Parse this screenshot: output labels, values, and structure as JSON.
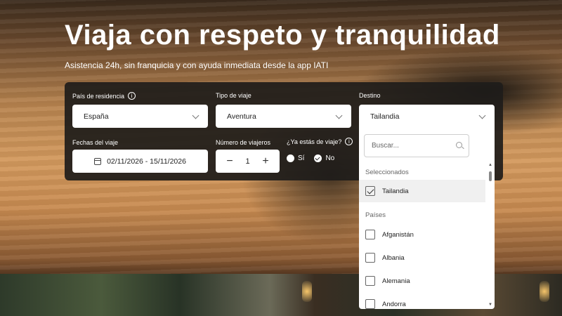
{
  "hero": {
    "title": "Viaja con respeto y tranquilidad",
    "subtitle": "Asistencia 24h, sin franquicia y con ayuda inmediata desde la app IATI"
  },
  "form": {
    "residence": {
      "label": "País de residencia",
      "value": "España",
      "icon": "info-icon"
    },
    "trip_type": {
      "label": "Tipo de viaje",
      "value": "Aventura"
    },
    "destination": {
      "label": "Destino",
      "value": "Tailandia"
    },
    "dates": {
      "label": "Fechas del viaje",
      "value": "02/11/2026 - 15/11/2026",
      "icon": "calendar-icon"
    },
    "travelers": {
      "label": "Número de viajeros",
      "value": "1",
      "minus": "−",
      "plus": "+"
    },
    "already_traveling": {
      "label": "¿Ya estás de viaje?",
      "options": [
        {
          "label": "Sí",
          "checked": false
        },
        {
          "label": "No",
          "checked": true
        }
      ]
    }
  },
  "dropdown": {
    "search_placeholder": "Buscar...",
    "selected_header": "Seleccionados",
    "selected_items": [
      {
        "label": "Tailandia",
        "checked": true
      }
    ],
    "countries_header": "Países",
    "countries": [
      {
        "label": "Afganistán",
        "checked": false
      },
      {
        "label": "Albania",
        "checked": false
      },
      {
        "label": "Alemania",
        "checked": false
      },
      {
        "label": "Andorra",
        "checked": false
      }
    ]
  }
}
